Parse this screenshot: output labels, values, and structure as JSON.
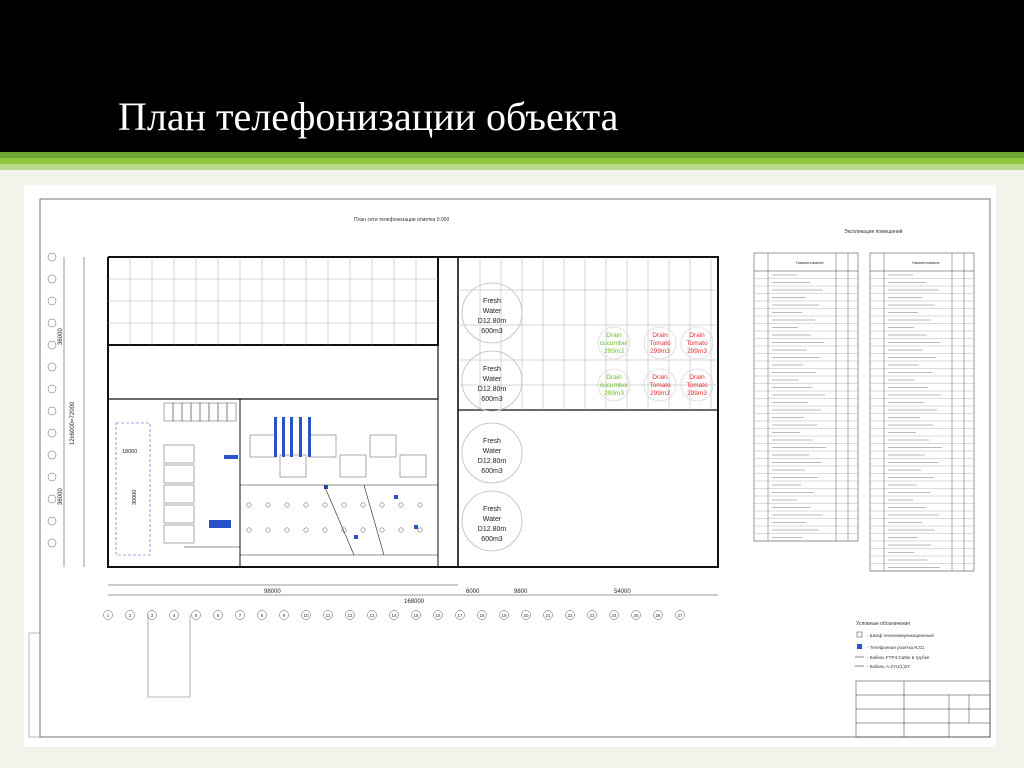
{
  "slide": {
    "title": "План телефонизации объекта"
  },
  "drawing": {
    "plan_title": "План сети телефонизации отметка 0.000",
    "rooms_table_title": "Экспликация помещений",
    "legend_title": "Условные обозначения",
    "tanks": [
      {
        "line1": "Fresh",
        "line2": "Water",
        "line3": "D12.80m",
        "line4": "600m3",
        "color": "#222222"
      },
      {
        "line1": "Fresh",
        "line2": "Water",
        "line3": "D12.80m",
        "line4": "600m3",
        "color": "#222222"
      },
      {
        "line1": "Fresh",
        "line2": "Water",
        "line3": "D12.80m",
        "line4": "600m3",
        "color": "#222222"
      },
      {
        "line1": "Fresh",
        "line2": "Water",
        "line3": "D12.80m",
        "line4": "600m3",
        "color": "#222222"
      }
    ],
    "small_tanks": [
      {
        "line1": "Drain",
        "line2": "cucumber",
        "line3": "299m3",
        "color": "#6cbf2a"
      },
      {
        "line1": "Drain",
        "line2": "Tomato",
        "line3": "299m3",
        "color": "#e03030"
      },
      {
        "line1": "Drain",
        "line2": "Tomato",
        "line3": "299m3",
        "color": "#e03030"
      },
      {
        "line1": "Drain",
        "line2": "cucumber",
        "line3": "299m3",
        "color": "#6cbf2a"
      },
      {
        "line1": "Drain",
        "line2": "Tomato",
        "line3": "299m3",
        "color": "#e03030"
      },
      {
        "line1": "Drain",
        "line2": "Tomato",
        "line3": "299m3",
        "color": "#e03030"
      }
    ],
    "dims": {
      "d1": "98000",
      "d2": "168000",
      "d3": "6000",
      "d4": "9800",
      "d5": "54000",
      "v1": "36000",
      "v2": "12x6000=72000",
      "v3": "36000",
      "v4": "18000",
      "v5": "30000"
    },
    "grid_numbers": [
      "1",
      "2",
      "3",
      "4",
      "5",
      "6",
      "7",
      "8",
      "9",
      "10",
      "11",
      "12",
      "13",
      "14",
      "15",
      "16",
      "17",
      "18",
      "19",
      "20",
      "21",
      "22",
      "23",
      "24",
      "25",
      "26",
      "27"
    ],
    "table_headers": {
      "num": "Номер поме-щения",
      "name": "Наименование",
      "area": "Площ. м2",
      "cat": "Кат. пом."
    },
    "legend": [
      "- Шкаф телекоммуникационный",
      "- Телефонная розетка RJ11",
      "- Кабель FTP4-Cat5e в трубке",
      "- Кабель A-2YU(L)2Y"
    ]
  }
}
